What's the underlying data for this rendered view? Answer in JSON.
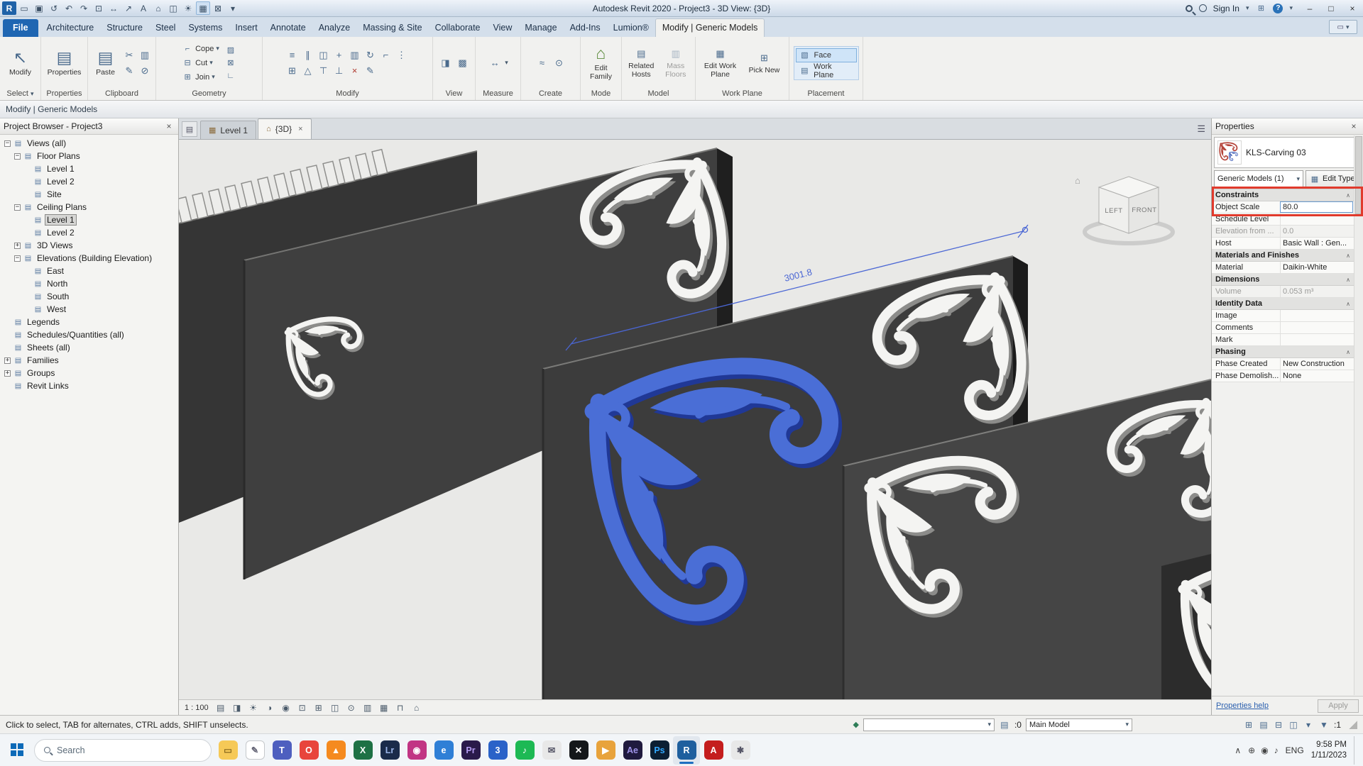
{
  "icons": {
    "caret_down": "▾",
    "close": "×",
    "minimize": "–",
    "maximize": "□",
    "menu": "☰",
    "chevron_up": "∧",
    "collapse": "∧",
    "filter": "▼",
    "edit_type": "▦",
    "paste_glyph": "▤",
    "properties_glyph": "▤",
    "cursor": "↖",
    "edit_family_glyph": "⌂",
    "related_hosts_glyph": "▤",
    "mass_floors_glyph": "▥",
    "edit_workplane_glyph": "▦",
    "pick_new_glyph": "⊞",
    "measure_glyph": "↔",
    "list_glyph": "▤"
  },
  "title_bar": {
    "title": "Autodesk Revit 2020 - Project3 - 3D View: {3D}",
    "sign_in": "Sign In",
    "qat": [
      {
        "name": "revit-logo",
        "glyph": "R",
        "logo": true
      },
      {
        "name": "open-icon",
        "glyph": "▭"
      },
      {
        "name": "save-icon",
        "glyph": "▣"
      },
      {
        "name": "sync-icon",
        "glyph": "↺"
      },
      {
        "name": "undo-icon",
        "glyph": "↶"
      },
      {
        "name": "redo-icon",
        "glyph": "↷"
      },
      {
        "name": "print-icon",
        "glyph": "⊡"
      },
      {
        "name": "measure-icon",
        "glyph": "↔"
      },
      {
        "name": "dimension-icon",
        "glyph": "↗"
      },
      {
        "name": "text-icon",
        "glyph": "A"
      },
      {
        "name": "default-3d-view-icon",
        "glyph": "⌂"
      },
      {
        "name": "section-icon",
        "glyph": "◫"
      },
      {
        "name": "sun-icon",
        "glyph": "☀"
      },
      {
        "name": "thin-lines-icon",
        "glyph": "▦",
        "hl": true
      },
      {
        "name": "close-hidden-icon",
        "glyph": "⊠"
      },
      {
        "name": "qat-caret-icon",
        "glyph": "▾"
      }
    ]
  },
  "ribbon": {
    "tabs": [
      {
        "label": "File",
        "style": "file"
      },
      {
        "label": "Architecture"
      },
      {
        "label": "Structure"
      },
      {
        "label": "Steel"
      },
      {
        "label": "Systems"
      },
      {
        "label": "Insert"
      },
      {
        "label": "Annotate"
      },
      {
        "label": "Analyze"
      },
      {
        "label": "Massing & Site"
      },
      {
        "label": "Collaborate"
      },
      {
        "label": "View"
      },
      {
        "label": "Manage"
      },
      {
        "label": "Add-Ins"
      },
      {
        "label": "Lumion®"
      },
      {
        "label": "Modify | Generic Models",
        "style": "active"
      }
    ],
    "select_panel": {
      "label": "Select",
      "modify_label": "Modify"
    },
    "properties_panel": {
      "label": "Properties",
      "button": "Properties"
    },
    "clipboard_panel": {
      "label": "Clipboard",
      "paste": "Paste",
      "icons": [
        {
          "name": "cut-icon",
          "glyph": "✂"
        },
        {
          "name": "copy-icon",
          "glyph": "▥"
        },
        {
          "name": "match-type-icon",
          "glyph": "✎"
        },
        {
          "name": "delete-clip-icon",
          "glyph": "⊘"
        }
      ]
    },
    "geometry_panel": {
      "label": "Geometry",
      "rows": [
        {
          "label": "Cope",
          "glyph": "⌐"
        },
        {
          "label": "Cut",
          "glyph": "⊟"
        },
        {
          "label": "Join",
          "glyph": "⊞"
        }
      ],
      "side_icons": [
        {
          "name": "paint-icon",
          "glyph": "▨"
        },
        {
          "name": "demolish-icon",
          "glyph": "⊠"
        },
        {
          "name": "wall-joins-icon",
          "glyph": "∟"
        }
      ]
    },
    "modify_panel": {
      "label": "Modify",
      "icons": [
        {
          "name": "align-icon",
          "glyph": "≡"
        },
        {
          "name": "offset-icon",
          "glyph": "∥"
        },
        {
          "name": "mirror-icon",
          "glyph": "◫"
        },
        {
          "name": "move-icon",
          "glyph": "+"
        },
        {
          "name": "copy-icon",
          "glyph": "▥"
        },
        {
          "name": "rotate-icon",
          "glyph": "↻"
        },
        {
          "name": "trim-icon",
          "glyph": "⌐"
        },
        {
          "name": "split-icon",
          "glyph": "⋮"
        },
        {
          "name": "array-icon",
          "glyph": "⊞"
        },
        {
          "name": "scale-icon",
          "glyph": "△"
        },
        {
          "name": "pin-icon",
          "glyph": "⊤"
        },
        {
          "name": "unpin-icon",
          "glyph": "⊥"
        },
        {
          "name": "delete-icon",
          "glyph": "×",
          "color": "#b03a30"
        },
        {
          "name": "match-icon",
          "glyph": "✎"
        }
      ]
    },
    "view_panel": {
      "label": "View",
      "icons": [
        {
          "name": "hide-elements-icon",
          "glyph": "◨"
        },
        {
          "name": "override-graphics-icon",
          "glyph": "▩"
        }
      ]
    },
    "measure_panel": {
      "label": "Measure",
      "icons": [
        {
          "name": "measure-tool-icon",
          "glyph": "↔"
        }
      ]
    },
    "create_panel": {
      "label": "Create",
      "icons": [
        {
          "name": "insulation-icon",
          "glyph": "≈"
        },
        {
          "name": "create-similar-icon",
          "glyph": "⊙"
        }
      ]
    },
    "mode_panel": {
      "label": "Mode",
      "button": "Edit Family"
    },
    "model_panel": {
      "label": "Model",
      "buttons": [
        {
          "label": "Related Hosts"
        },
        {
          "label": "Mass Floors",
          "disabled": true
        }
      ]
    },
    "workplane_panel": {
      "label": "Work Plane",
      "buttons": [
        {
          "label": "Edit Work Plane"
        },
        {
          "label": "Pick New"
        }
      ]
    },
    "placement_panel": {
      "label": "Placement",
      "options": [
        {
          "label": "Face",
          "icon": "▧",
          "active": true
        },
        {
          "label": "Work Plane",
          "icon": "▤"
        }
      ]
    }
  },
  "options_bar": {
    "label": "Modify | Generic Models"
  },
  "project_browser": {
    "title": "Project Browser - Project3",
    "items": [
      {
        "label": "Views (all)",
        "indent": 0,
        "exp": "minus"
      },
      {
        "label": "Floor Plans",
        "indent": 1,
        "exp": "minus"
      },
      {
        "label": "Level 1",
        "indent": 2
      },
      {
        "label": "Level 2",
        "indent": 2
      },
      {
        "label": "Site",
        "indent": 2
      },
      {
        "label": "Ceiling Plans",
        "indent": 1,
        "exp": "minus"
      },
      {
        "label": "Level 1",
        "indent": 2,
        "selected": true
      },
      {
        "label": "Level 2",
        "indent": 2
      },
      {
        "label": "3D Views",
        "indent": 1,
        "exp": "plus"
      },
      {
        "label": "Elevations (Building Elevation)",
        "indent": 1,
        "exp": "minus"
      },
      {
        "label": "East",
        "indent": 2
      },
      {
        "label": "North",
        "indent": 2
      },
      {
        "label": "South",
        "indent": 2
      },
      {
        "label": "West",
        "indent": 2
      },
      {
        "label": "Legends",
        "indent": 0
      },
      {
        "label": "Schedules/Quantities (all)",
        "indent": 0
      },
      {
        "label": "Sheets (all)",
        "indent": 0
      },
      {
        "label": "Families",
        "indent": 0,
        "exp": "plus"
      },
      {
        "label": "Groups",
        "indent": 0,
        "exp": "plus"
      },
      {
        "label": "Revit Links",
        "indent": 0
      }
    ]
  },
  "viewport": {
    "view_tabs": [
      {
        "label": "Level 1",
        "icon": "▦"
      },
      {
        "label": "{3D}",
        "icon": "⌂",
        "active": true
      }
    ],
    "dimension_label": "3001.8",
    "viewcube": {
      "left_label": "LEFT",
      "front_label": "FRONT"
    },
    "controls": {
      "scale": "1 : 100",
      "icons": [
        {
          "name": "detail-level-icon",
          "glyph": "▤"
        },
        {
          "name": "visual-style-icon",
          "glyph": "◨"
        },
        {
          "name": "sun-path-icon",
          "glyph": "☀"
        },
        {
          "name": "shadows-icon",
          "glyph": "◑"
        },
        {
          "name": "render-icon",
          "glyph": "◉"
        },
        {
          "name": "crop-view-icon",
          "glyph": "⊡"
        },
        {
          "name": "show-crop-icon",
          "glyph": "⊞"
        },
        {
          "name": "temporary-hide-icon",
          "glyph": "◫"
        },
        {
          "name": "reveal-hidden-icon",
          "glyph": "⊙"
        },
        {
          "name": "worksharing-display-icon",
          "glyph": "▥"
        },
        {
          "name": "temporary-view-icon",
          "glyph": "▦"
        },
        {
          "name": "constraints-icon",
          "glyph": "⊓"
        },
        {
          "name": "analytical-model-icon",
          "glyph": "⌂"
        }
      ]
    }
  },
  "properties_panel": {
    "title": "Properties",
    "type_name": "KLS-Carving 03",
    "filter": "Generic Models (1)",
    "edit_type": "Edit Type",
    "rows": [
      {
        "type": "section",
        "label": "Constraints"
      },
      {
        "type": "row",
        "label": "Object Scale",
        "value": "80.0",
        "edit": true
      },
      {
        "type": "row",
        "label": "Schedule Level",
        "value": ""
      },
      {
        "type": "row",
        "label": "Elevation from ...",
        "value": "0.0",
        "grayed": true
      },
      {
        "type": "row",
        "label": "Host",
        "value": "Basic Wall : Gen..."
      },
      {
        "type": "section",
        "label": "Materials and Finishes"
      },
      {
        "type": "row",
        "label": "Material",
        "value": "Daikin-White"
      },
      {
        "type": "section",
        "label": "Dimensions"
      },
      {
        "type": "row",
        "label": "Volume",
        "value": "0.053 m³",
        "grayed": true
      },
      {
        "type": "section",
        "label": "Identity Data"
      },
      {
        "type": "row",
        "label": "Image",
        "value": ""
      },
      {
        "type": "row",
        "label": "Comments",
        "value": ""
      },
      {
        "type": "row",
        "label": "Mark",
        "value": ""
      },
      {
        "type": "section",
        "label": "Phasing"
      },
      {
        "type": "row",
        "label": "Phase Created",
        "value": "New Construction"
      },
      {
        "type": "row",
        "label": "Phase Demolish...",
        "value": "None"
      }
    ],
    "help_link": "Properties help",
    "apply_label": "Apply"
  },
  "status_bar": {
    "hint": "Click to select, TAB for alternates, CTRL adds, SHIFT unselects.",
    "workset_value": "",
    "editable_count": ":0",
    "design_option": "Main Model",
    "filter_count": ":1",
    "mini_icons": [
      "⊞",
      "▤",
      "⊟",
      "◫",
      "▾"
    ]
  },
  "taskbar": {
    "search_placeholder": "Search",
    "apps": [
      {
        "name": "file-explorer",
        "glyph": "▭",
        "bg": "#f6c957",
        "fg": "#8a6a1f"
      },
      {
        "name": "notes-app",
        "glyph": "✎",
        "bg": "#ffffff",
        "fg": "#667",
        "border": true
      },
      {
        "name": "teams",
        "glyph": "T",
        "bg": "#4e5fbf",
        "fg": "#fff"
      },
      {
        "name": "opera",
        "glyph": "O",
        "bg": "#e8453c",
        "fg": "#fff"
      },
      {
        "name": "vlc",
        "glyph": "▲",
        "bg": "#f58a1f",
        "fg": "#fff"
      },
      {
        "name": "excel",
        "glyph": "X",
        "bg": "#1e7145",
        "fg": "#fff"
      },
      {
        "name": "lightroom",
        "glyph": "Lr",
        "bg": "#1a2b4a",
        "fg": "#9ab4e8"
      },
      {
        "name": "instagram",
        "glyph": "◉",
        "bg": "#c13584",
        "fg": "#fff"
      },
      {
        "name": "edge",
        "glyph": "e",
        "bg": "#2f7fd6",
        "fg": "#fff"
      },
      {
        "name": "premiere",
        "glyph": "Pr",
        "bg": "#2a1a4a",
        "fg": "#b49bf0"
      },
      {
        "name": "blue-app",
        "glyph": "3",
        "bg": "#2a62c8",
        "fg": "#fff"
      },
      {
        "name": "spotify",
        "glyph": "♪",
        "bg": "#1db954",
        "fg": "#fff"
      },
      {
        "name": "mail",
        "glyph": "✉",
        "bg": "#e8e8e8",
        "fg": "#556"
      },
      {
        "name": "x-app",
        "glyph": "✕",
        "bg": "#14171a",
        "fg": "#fff"
      },
      {
        "name": "media-app",
        "glyph": "▶",
        "bg": "#e8a33c",
        "fg": "#fff"
      },
      {
        "name": "after-effects",
        "glyph": "Ae",
        "bg": "#1f1a3e",
        "fg": "#9f93e8"
      },
      {
        "name": "photoshop",
        "glyph": "Ps",
        "bg": "#0b1f33",
        "fg": "#31a8ff"
      },
      {
        "name": "revit",
        "glyph": "R",
        "bg": "#1e5f9e",
        "fg": "#fff",
        "active": true
      },
      {
        "name": "acrobat",
        "glyph": "A",
        "bg": "#c41e1e",
        "fg": "#fff"
      },
      {
        "name": "settings",
        "glyph": "✱",
        "bg": "#e8e8e8",
        "fg": "#556"
      }
    ],
    "tray": {
      "icons": [
        "⊕",
        "◉",
        "♪"
      ],
      "lang": "ENG",
      "time": "9:58 PM",
      "date": "1/11/2023"
    }
  }
}
